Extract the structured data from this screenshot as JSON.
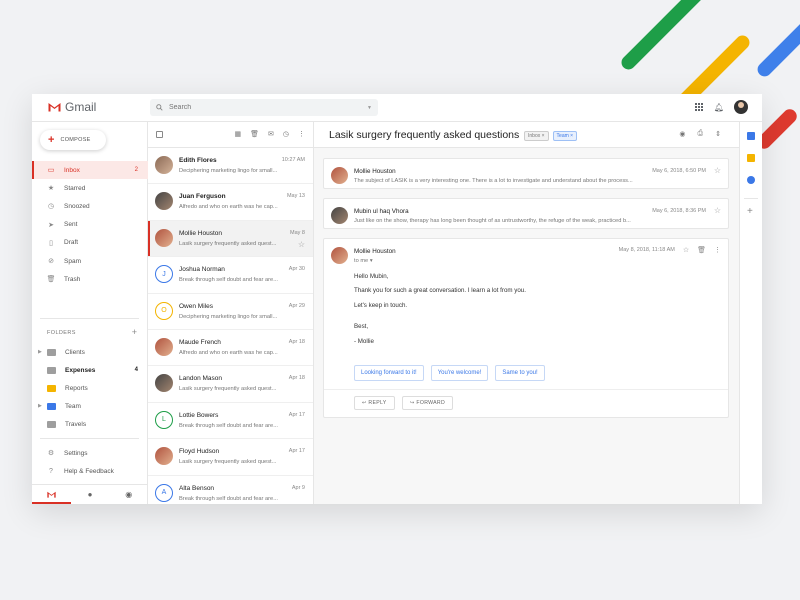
{
  "app": {
    "name": "Gmail"
  },
  "search": {
    "placeholder": "Search"
  },
  "compose": {
    "label": "COMPOSE"
  },
  "nav": [
    {
      "label": "Inbox",
      "count": "2",
      "icon": "inbox-icon"
    },
    {
      "label": "Starred",
      "count": "",
      "icon": "star-icon"
    },
    {
      "label": "Snoozed",
      "count": "",
      "icon": "clock-icon"
    },
    {
      "label": "Sent",
      "count": "",
      "icon": "send-icon"
    },
    {
      "label": "Draft",
      "count": "",
      "icon": "draft-icon"
    },
    {
      "label": "Spam",
      "count": "",
      "icon": "spam-icon"
    },
    {
      "label": "Trash",
      "count": "",
      "icon": "trash-icon"
    }
  ],
  "folders": {
    "heading": "FOLDERS",
    "items": [
      {
        "label": "Clients",
        "count": "",
        "color": "#9e9e9e"
      },
      {
        "label": "Expenses",
        "count": "4",
        "color": "#9e9e9e"
      },
      {
        "label": "Reports",
        "count": "",
        "color": "#f4b400"
      },
      {
        "label": "Team",
        "count": "",
        "color": "#3b78e7"
      },
      {
        "label": "Travels",
        "count": "",
        "color": "#9e9e9e"
      }
    ]
  },
  "bottom_nav": [
    {
      "label": "Settings",
      "icon": "gear-icon"
    },
    {
      "label": "Help & Feedback",
      "icon": "help-icon"
    }
  ],
  "messages": [
    {
      "name": "Edith Flores",
      "snippet": "Deciphering marketing lingo for small...",
      "date": "10:27 AM",
      "unread": true,
      "avatar": "photo",
      "initial": ""
    },
    {
      "name": "Juan Ferguson",
      "snippet": "Alfredo and who on earth was he cap...",
      "date": "May 13",
      "unread": true,
      "avatar": "photo2",
      "initial": ""
    },
    {
      "name": "Mollie Houston",
      "snippet": "Lasik surgery frequently asked quest...",
      "date": "May 8",
      "unread": false,
      "avatar": "photo3",
      "initial": ""
    },
    {
      "name": "Joshua Norman",
      "snippet": "Break through self doubt and fear are...",
      "date": "Apr 30",
      "unread": false,
      "avatar": "letter",
      "initial": "J",
      "color": "#3b78e7"
    },
    {
      "name": "Owen Miles",
      "snippet": "Deciphering marketing lingo for small...",
      "date": "Apr 29",
      "unread": false,
      "avatar": "letter",
      "initial": "O",
      "color": "#f4b400"
    },
    {
      "name": "Maude French",
      "snippet": "Alfredo and who on earth was he cap...",
      "date": "Apr 18",
      "unread": false,
      "avatar": "photo3",
      "initial": ""
    },
    {
      "name": "Landon Mason",
      "snippet": "Lasik surgery frequently asked quest...",
      "date": "Apr 18",
      "unread": false,
      "avatar": "photo2",
      "initial": ""
    },
    {
      "name": "Lottie Bowers",
      "snippet": "Break through self doubt and fear are...",
      "date": "Apr 17",
      "unread": false,
      "avatar": "letter",
      "initial": "L",
      "color": "#1e9e48"
    },
    {
      "name": "Floyd Hudson",
      "snippet": "Lasik surgery frequently asked quest...",
      "date": "Apr 17",
      "unread": false,
      "avatar": "photo3",
      "initial": ""
    },
    {
      "name": "Alta Benson",
      "snippet": "Break through self doubt and fear are...",
      "date": "Apr 9",
      "unread": false,
      "avatar": "letter",
      "initial": "A",
      "color": "#3b78e7"
    }
  ],
  "thread": {
    "subject": "Lasik surgery frequently asked questions",
    "labels": [
      "Inbox",
      "Team"
    ],
    "collapsed": [
      {
        "from": "Mollie Houston",
        "snippet": "The subject of LASIK is a very interesting one. There is a lot to investigate and understand about the process...",
        "date": "May 6, 2018, 6:50 PM"
      },
      {
        "from": "Mubin ul haq Vhora",
        "snippet": "Just like on the show, therapy has long been thought of as untrustworthy, the refuge of the weak, practiced b...",
        "date": "May 6, 2018, 8:36 PM"
      }
    ],
    "open": {
      "from": "Mollie Houston",
      "to": "to me",
      "date": "May 8, 2018, 11:18 AM",
      "lines": [
        "Hello Mubin,",
        "Thank you for such a great conversation. I learn a lot from you.",
        "Let's keep in touch.",
        "",
        "Best,",
        "- Mollie"
      ],
      "smart_replies": [
        "Looking forward to it!",
        "You're welcome!",
        "Same to you!"
      ],
      "reply_label": "REPLY",
      "forward_label": "FORWARD"
    }
  },
  "colors": {
    "accent": "#d93025",
    "link": "#3b78e7"
  }
}
